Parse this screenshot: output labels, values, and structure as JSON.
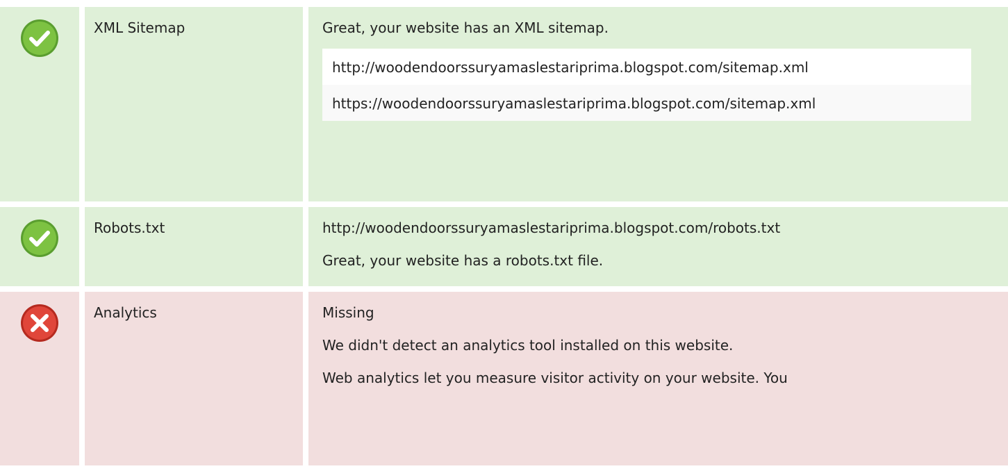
{
  "colors": {
    "ok_bg": "#dff0d8",
    "error_bg": "#f2dede",
    "ok_icon": "#6db33f",
    "error_icon": "#e0392b"
  },
  "rows": [
    {
      "status": "ok",
      "icon": "check-circle-icon",
      "name": "XML Sitemap",
      "lines": [
        "Great, your website has an XML sitemap."
      ],
      "urls": [
        "http://woodendoorssuryamaslestariprima.blogspot.com/sitemap.xml",
        "https://woodendoorssuryamaslestariprima.blogspot.com/sitemap.xml"
      ]
    },
    {
      "status": "ok",
      "icon": "check-circle-icon",
      "name": "Robots.txt",
      "lines": [
        "http://woodendoorssuryamaslestariprima.blogspot.com/robots.txt",
        "Great, your website has a robots.txt file."
      ]
    },
    {
      "status": "error",
      "icon": "x-circle-icon",
      "name": "Analytics",
      "lines": [
        "Missing",
        "We didn't detect an analytics tool installed on this website.",
        "Web analytics let you measure visitor activity on your website. You"
      ]
    }
  ]
}
